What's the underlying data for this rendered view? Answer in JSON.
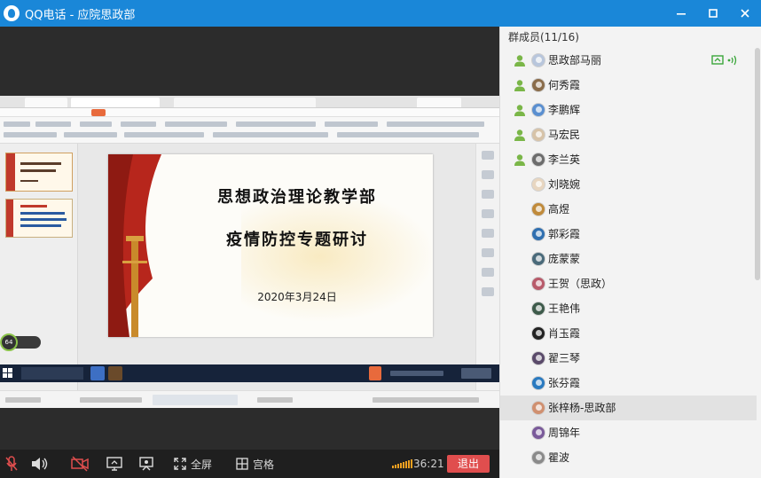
{
  "window": {
    "title": "QQ电话 - 应院思政部"
  },
  "slide": {
    "title_line1": "思想政治理论教学部",
    "title_line2": "疫情防控专题研讨",
    "date": "2020年3月24日"
  },
  "network_badge": {
    "value": "64"
  },
  "controls": {
    "fullscreen_label": "全屏",
    "grid_label": "宫格",
    "timer": "36:21",
    "hangup_label": "退出"
  },
  "members": {
    "header": "群成员(11/16)",
    "list": [
      {
        "name": "思政部马丽",
        "online": true,
        "sharing": true,
        "avatar_color": "#b8c6dc"
      },
      {
        "name": "何秀霞",
        "online": true,
        "sharing": false,
        "avatar_color": "#8a6c4a"
      },
      {
        "name": "李鹏辉",
        "online": true,
        "sharing": false,
        "avatar_color": "#5a8fd0"
      },
      {
        "name": "马宏民",
        "online": true,
        "sharing": false,
        "avatar_color": "#d7c3a8"
      },
      {
        "name": "李兰英",
        "online": true,
        "sharing": false,
        "avatar_color": "#6c6c6c"
      },
      {
        "name": "刘晓婉",
        "online": false,
        "sharing": false,
        "avatar_color": "#e8d6c0"
      },
      {
        "name": "高煜",
        "online": false,
        "sharing": false,
        "avatar_color": "#c08a3a"
      },
      {
        "name": "郭彩霞",
        "online": false,
        "sharing": false,
        "avatar_color": "#2f6fb0"
      },
      {
        "name": "庞蒙蒙",
        "online": false,
        "sharing": false,
        "avatar_color": "#4a6a7a"
      },
      {
        "name": "王贺（思政）",
        "online": false,
        "sharing": false,
        "avatar_color": "#b85a6a"
      },
      {
        "name": "王艳伟",
        "online": false,
        "sharing": false,
        "avatar_color": "#3d5a4a"
      },
      {
        "name": "肖玉霞",
        "online": false,
        "sharing": false,
        "avatar_color": "#222222"
      },
      {
        "name": "翟三琴",
        "online": false,
        "sharing": false,
        "avatar_color": "#5a4a6a"
      },
      {
        "name": "张芬霞",
        "online": false,
        "sharing": false,
        "avatar_color": "#2a7ac0"
      },
      {
        "name": "张梓杨-思政部",
        "online": false,
        "sharing": false,
        "avatar_color": "#d09070"
      },
      {
        "name": "周锦年",
        "online": false,
        "sharing": false,
        "avatar_color": "#7a5a9a"
      },
      {
        "name": "瞿波",
        "online": false,
        "sharing": false,
        "avatar_color": "#8a8a8a"
      }
    ],
    "selected_index": 14
  },
  "colors": {
    "titlebar": "#1a87d8",
    "hangup": "#e04e4e",
    "online_person": "#7ab648",
    "share_green": "#3aa63a"
  }
}
